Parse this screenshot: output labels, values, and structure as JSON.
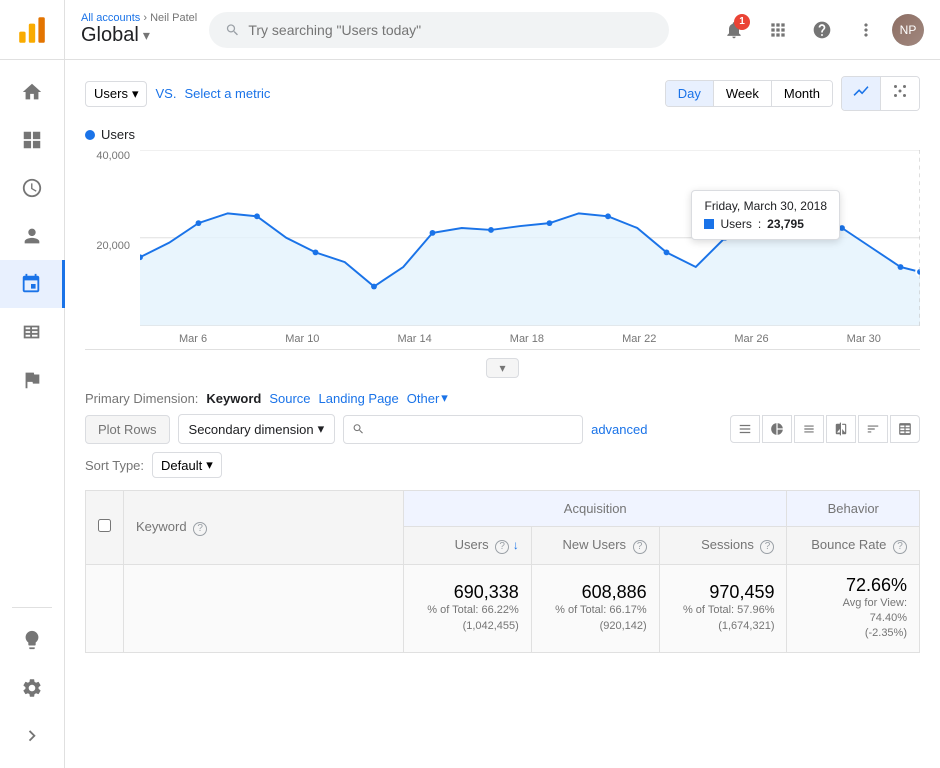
{
  "topbar": {
    "breadcrumb": "All accounts",
    "breadcrumb_separator": "›",
    "breadcrumb_current": "Neil Patel",
    "title": "Global",
    "title_arrow": "▾",
    "search_placeholder": "Try searching \"Users today\"",
    "notification_count": "1",
    "user_initials": "NP"
  },
  "sidebar": {
    "items": [
      {
        "name": "home",
        "icon": "home",
        "active": false
      },
      {
        "name": "dashboard",
        "icon": "dashboard",
        "active": false
      },
      {
        "name": "reports",
        "icon": "clock",
        "active": false
      },
      {
        "name": "user",
        "icon": "person",
        "active": false
      },
      {
        "name": "acquisitions",
        "icon": "fork",
        "active": true
      },
      {
        "name": "behavior",
        "icon": "table",
        "active": false
      },
      {
        "name": "goals",
        "icon": "flag",
        "active": false
      }
    ],
    "bottom_items": [
      {
        "name": "lightbulb",
        "icon": "bulb"
      },
      {
        "name": "settings",
        "icon": "gear"
      },
      {
        "name": "expand",
        "icon": "chevron-right"
      }
    ]
  },
  "chart_controls": {
    "metric_label": "Users",
    "vs_label": "VS.",
    "select_metric_label": "Select a metric",
    "time_buttons": [
      {
        "label": "Day",
        "active": true
      },
      {
        "label": "Week",
        "active": false
      },
      {
        "label": "Month",
        "active": false
      }
    ]
  },
  "chart": {
    "legend_label": "Users",
    "y_labels": [
      "40,000",
      "20,000"
    ],
    "x_labels": [
      "Mar 6",
      "Mar 10",
      "Mar 14",
      "Mar 18",
      "Mar 22",
      "Mar 26",
      "Mar 30"
    ],
    "tooltip": {
      "date": "Friday, March 30, 2018",
      "metric": "Users",
      "value": "23,795"
    }
  },
  "dimensions": {
    "label": "Primary Dimension:",
    "items": [
      {
        "label": "Keyword",
        "active": true
      },
      {
        "label": "Source",
        "active": false
      },
      {
        "label": "Landing Page",
        "active": false
      },
      {
        "label": "Other",
        "active": false
      }
    ]
  },
  "toolbar": {
    "plot_rows_label": "Plot Rows",
    "secondary_dim_label": "Secondary dimension",
    "search_placeholder": "",
    "advanced_label": "advanced",
    "sort_label": "Sort Type:",
    "sort_default": "Default"
  },
  "table": {
    "sections": [
      {
        "label": "Acquisition",
        "colspan": 3
      },
      {
        "label": "Behavior",
        "colspan": 1
      }
    ],
    "columns": [
      {
        "label": "Keyword",
        "help": true
      },
      {
        "label": "Users",
        "help": true,
        "sort": true
      },
      {
        "label": "New Users",
        "help": true
      },
      {
        "label": "Sessions",
        "help": true
      },
      {
        "label": "Bounce Rate",
        "help": true
      }
    ],
    "totals": {
      "users_value": "690,338",
      "users_sub1": "% of Total: 66.22%",
      "users_sub2": "(1,042,455)",
      "new_users_value": "608,886",
      "new_users_sub1": "% of Total: 66.17%",
      "new_users_sub2": "(920,142)",
      "sessions_value": "970,459",
      "sessions_sub1": "% of Total: 57.96%",
      "sessions_sub2": "(1,674,321)",
      "bounce_value": "72.66%",
      "bounce_sub1": "Avg for View:",
      "bounce_sub2": "74.40%",
      "bounce_sub3": "(-2.35%)"
    }
  }
}
